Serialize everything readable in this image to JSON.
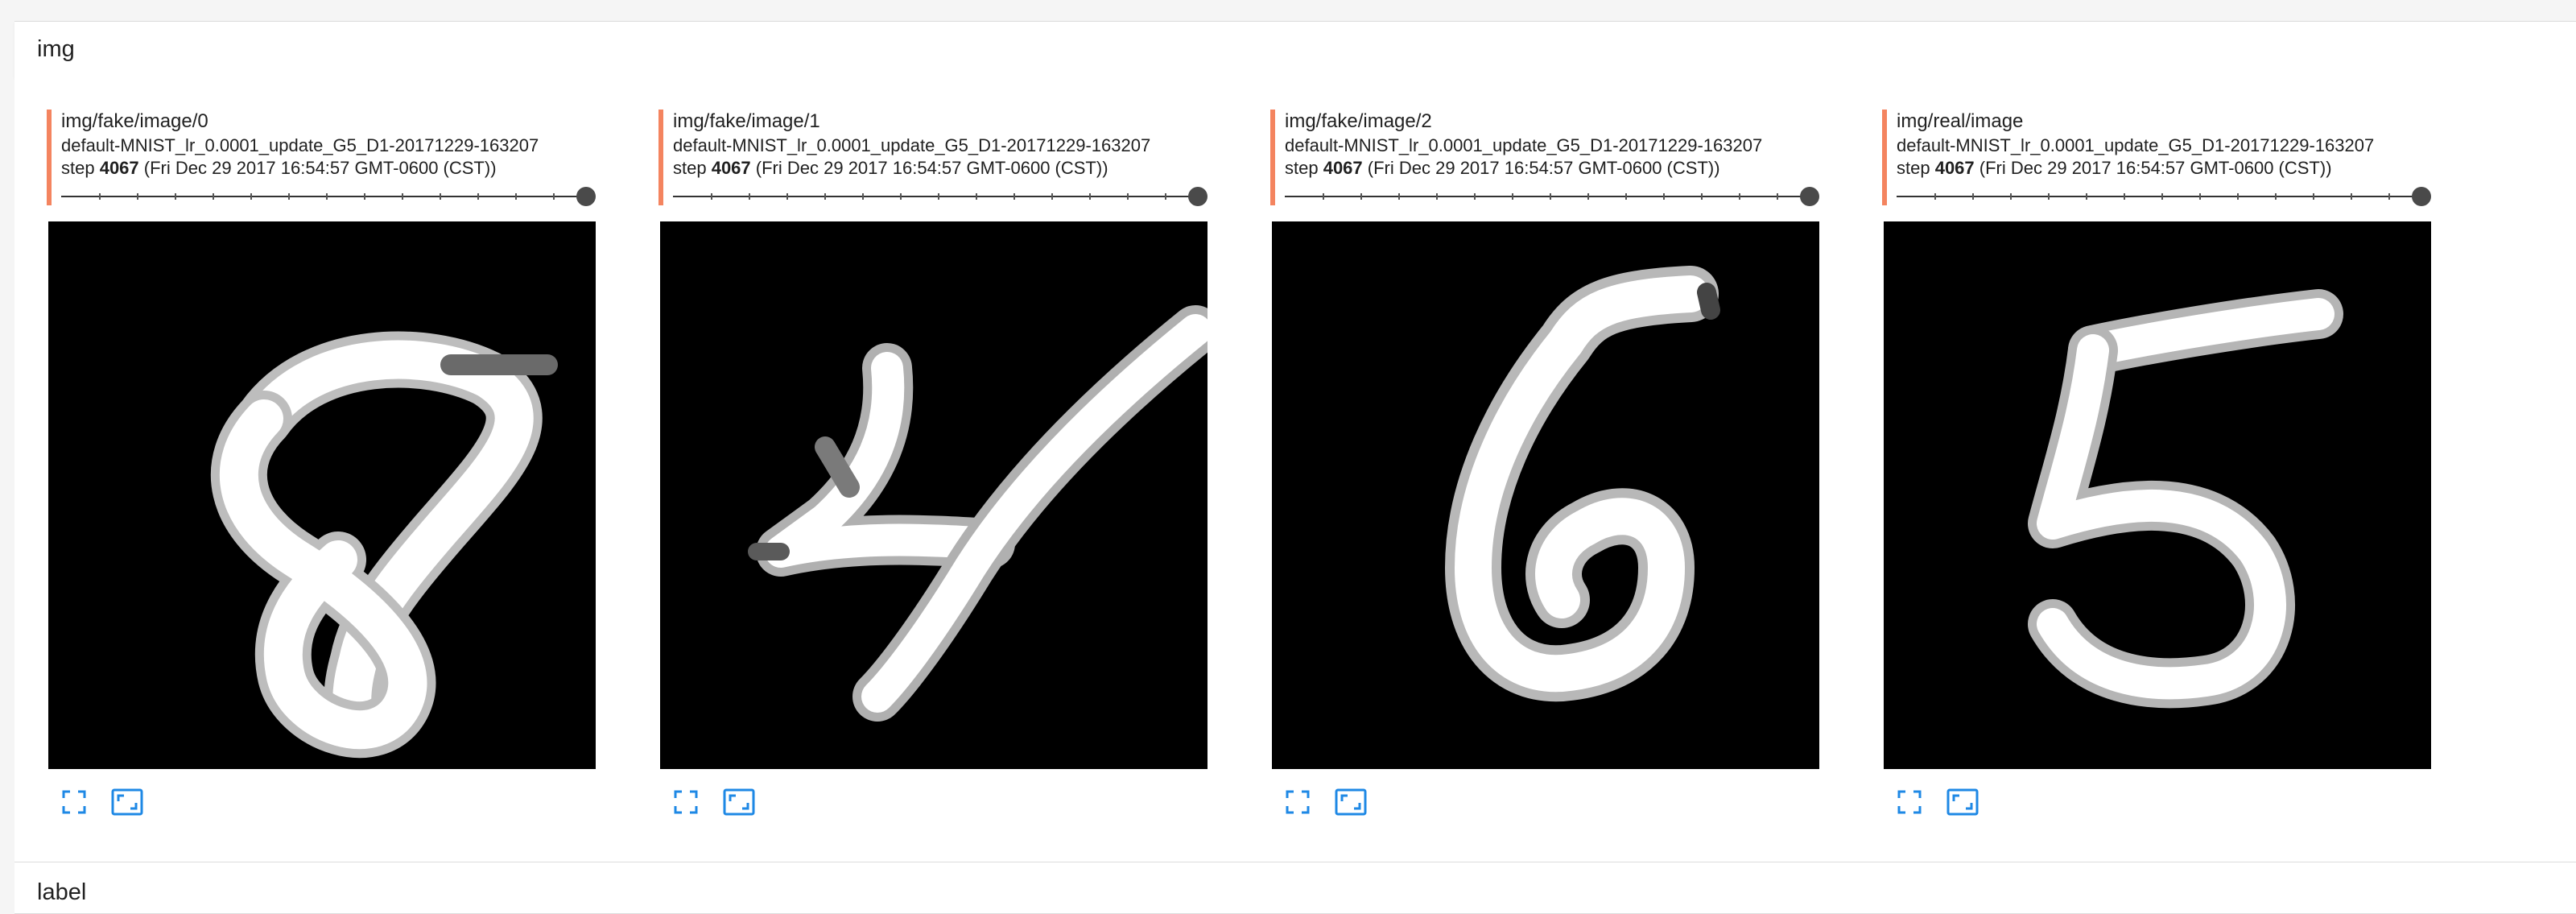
{
  "sections": {
    "img": {
      "title": "img"
    },
    "label": {
      "title": "label"
    }
  },
  "accent_color": "#f4845f",
  "cards": [
    {
      "tag": "img/fake/image/0",
      "run": "default-MNIST_lr_0.0001_update_G5_D1-20171229-163207",
      "step_prefix": "step ",
      "step": "4067",
      "timestamp": "(Fri Dec 29 2017 16:54:57 GMT-0600 (CST))",
      "digit": "8",
      "fullscreen_icon": "fullscreen-icon",
      "actual_size_icon": "actual-size-icon"
    },
    {
      "tag": "img/fake/image/1",
      "run": "default-MNIST_lr_0.0001_update_G5_D1-20171229-163207",
      "step_prefix": "step ",
      "step": "4067",
      "timestamp": "(Fri Dec 29 2017 16:54:57 GMT-0600 (CST))",
      "digit": "4",
      "fullscreen_icon": "fullscreen-icon",
      "actual_size_icon": "actual-size-icon"
    },
    {
      "tag": "img/fake/image/2",
      "run": "default-MNIST_lr_0.0001_update_G5_D1-20171229-163207",
      "step_prefix": "step ",
      "step": "4067",
      "timestamp": "(Fri Dec 29 2017 16:54:57 GMT-0600 (CST))",
      "digit": "6",
      "fullscreen_icon": "fullscreen-icon",
      "actual_size_icon": "actual-size-icon"
    },
    {
      "tag": "img/real/image",
      "run": "default-MNIST_lr_0.0001_update_G5_D1-20171229-163207",
      "step_prefix": "step ",
      "step": "4067",
      "timestamp": "(Fri Dec 29 2017 16:54:57 GMT-0600 (CST))",
      "digit": "5",
      "fullscreen_icon": "fullscreen-icon",
      "actual_size_icon": "actual-size-icon"
    }
  ]
}
